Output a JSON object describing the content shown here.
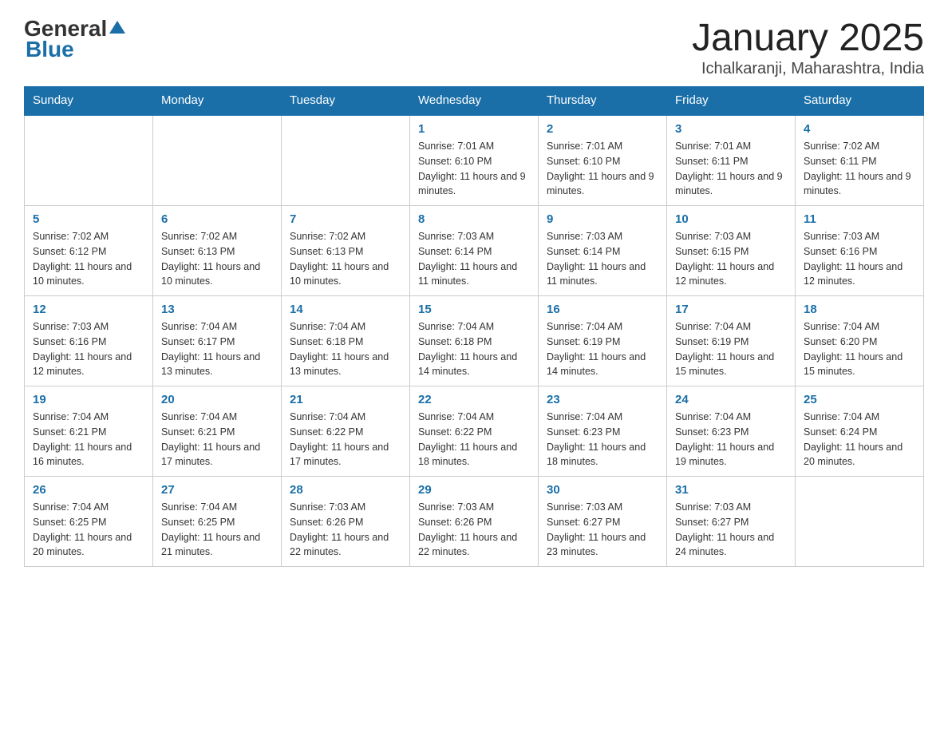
{
  "header": {
    "logo_general": "General",
    "logo_blue": "Blue",
    "title": "January 2025",
    "subtitle": "Ichalkaranji, Maharashtra, India"
  },
  "days_of_week": [
    "Sunday",
    "Monday",
    "Tuesday",
    "Wednesday",
    "Thursday",
    "Friday",
    "Saturday"
  ],
  "weeks": [
    [
      {
        "day": "",
        "info": ""
      },
      {
        "day": "",
        "info": ""
      },
      {
        "day": "",
        "info": ""
      },
      {
        "day": "1",
        "info": "Sunrise: 7:01 AM\nSunset: 6:10 PM\nDaylight: 11 hours and 9 minutes."
      },
      {
        "day": "2",
        "info": "Sunrise: 7:01 AM\nSunset: 6:10 PM\nDaylight: 11 hours and 9 minutes."
      },
      {
        "day": "3",
        "info": "Sunrise: 7:01 AM\nSunset: 6:11 PM\nDaylight: 11 hours and 9 minutes."
      },
      {
        "day": "4",
        "info": "Sunrise: 7:02 AM\nSunset: 6:11 PM\nDaylight: 11 hours and 9 minutes."
      }
    ],
    [
      {
        "day": "5",
        "info": "Sunrise: 7:02 AM\nSunset: 6:12 PM\nDaylight: 11 hours and 10 minutes."
      },
      {
        "day": "6",
        "info": "Sunrise: 7:02 AM\nSunset: 6:13 PM\nDaylight: 11 hours and 10 minutes."
      },
      {
        "day": "7",
        "info": "Sunrise: 7:02 AM\nSunset: 6:13 PM\nDaylight: 11 hours and 10 minutes."
      },
      {
        "day": "8",
        "info": "Sunrise: 7:03 AM\nSunset: 6:14 PM\nDaylight: 11 hours and 11 minutes."
      },
      {
        "day": "9",
        "info": "Sunrise: 7:03 AM\nSunset: 6:14 PM\nDaylight: 11 hours and 11 minutes."
      },
      {
        "day": "10",
        "info": "Sunrise: 7:03 AM\nSunset: 6:15 PM\nDaylight: 11 hours and 12 minutes."
      },
      {
        "day": "11",
        "info": "Sunrise: 7:03 AM\nSunset: 6:16 PM\nDaylight: 11 hours and 12 minutes."
      }
    ],
    [
      {
        "day": "12",
        "info": "Sunrise: 7:03 AM\nSunset: 6:16 PM\nDaylight: 11 hours and 12 minutes."
      },
      {
        "day": "13",
        "info": "Sunrise: 7:04 AM\nSunset: 6:17 PM\nDaylight: 11 hours and 13 minutes."
      },
      {
        "day": "14",
        "info": "Sunrise: 7:04 AM\nSunset: 6:18 PM\nDaylight: 11 hours and 13 minutes."
      },
      {
        "day": "15",
        "info": "Sunrise: 7:04 AM\nSunset: 6:18 PM\nDaylight: 11 hours and 14 minutes."
      },
      {
        "day": "16",
        "info": "Sunrise: 7:04 AM\nSunset: 6:19 PM\nDaylight: 11 hours and 14 minutes."
      },
      {
        "day": "17",
        "info": "Sunrise: 7:04 AM\nSunset: 6:19 PM\nDaylight: 11 hours and 15 minutes."
      },
      {
        "day": "18",
        "info": "Sunrise: 7:04 AM\nSunset: 6:20 PM\nDaylight: 11 hours and 15 minutes."
      }
    ],
    [
      {
        "day": "19",
        "info": "Sunrise: 7:04 AM\nSunset: 6:21 PM\nDaylight: 11 hours and 16 minutes."
      },
      {
        "day": "20",
        "info": "Sunrise: 7:04 AM\nSunset: 6:21 PM\nDaylight: 11 hours and 17 minutes."
      },
      {
        "day": "21",
        "info": "Sunrise: 7:04 AM\nSunset: 6:22 PM\nDaylight: 11 hours and 17 minutes."
      },
      {
        "day": "22",
        "info": "Sunrise: 7:04 AM\nSunset: 6:22 PM\nDaylight: 11 hours and 18 minutes."
      },
      {
        "day": "23",
        "info": "Sunrise: 7:04 AM\nSunset: 6:23 PM\nDaylight: 11 hours and 18 minutes."
      },
      {
        "day": "24",
        "info": "Sunrise: 7:04 AM\nSunset: 6:23 PM\nDaylight: 11 hours and 19 minutes."
      },
      {
        "day": "25",
        "info": "Sunrise: 7:04 AM\nSunset: 6:24 PM\nDaylight: 11 hours and 20 minutes."
      }
    ],
    [
      {
        "day": "26",
        "info": "Sunrise: 7:04 AM\nSunset: 6:25 PM\nDaylight: 11 hours and 20 minutes."
      },
      {
        "day": "27",
        "info": "Sunrise: 7:04 AM\nSunset: 6:25 PM\nDaylight: 11 hours and 21 minutes."
      },
      {
        "day": "28",
        "info": "Sunrise: 7:03 AM\nSunset: 6:26 PM\nDaylight: 11 hours and 22 minutes."
      },
      {
        "day": "29",
        "info": "Sunrise: 7:03 AM\nSunset: 6:26 PM\nDaylight: 11 hours and 22 minutes."
      },
      {
        "day": "30",
        "info": "Sunrise: 7:03 AM\nSunset: 6:27 PM\nDaylight: 11 hours and 23 minutes."
      },
      {
        "day": "31",
        "info": "Sunrise: 7:03 AM\nSunset: 6:27 PM\nDaylight: 11 hours and 24 minutes."
      },
      {
        "day": "",
        "info": ""
      }
    ]
  ]
}
